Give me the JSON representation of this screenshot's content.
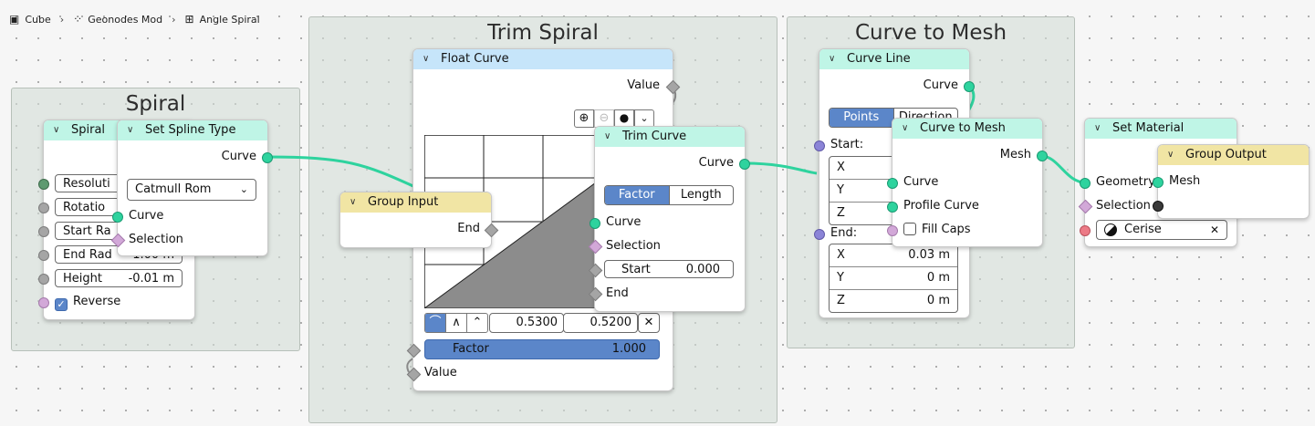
{
  "breadcrumb": [
    {
      "icon": "object-icon",
      "label": "Cube"
    },
    {
      "icon": "modifier-icon",
      "label": "Geonodes Mod"
    },
    {
      "icon": "node-tree-icon",
      "label": "Angle Spiral"
    }
  ],
  "frames": {
    "spiral": "Spiral",
    "trim": "Trim Spiral",
    "curve_to_mesh": "Curve to Mesh"
  },
  "spiral_node": {
    "title": "Spiral",
    "fields": [
      {
        "label": "Resoluti"
      },
      {
        "label": "Rotatio"
      },
      {
        "label": "Start Ra"
      },
      {
        "label": "End Rad",
        "value": "1.00 m"
      },
      {
        "label": "Height",
        "value": "-0.01 m"
      }
    ],
    "reverse_label": "Reverse",
    "reverse_checked": true
  },
  "set_spline_type": {
    "title": "Set Spline Type",
    "out_curve": "Curve",
    "dropdown": "Catmull Rom",
    "in_curve": "Curve",
    "in_selection": "Selection"
  },
  "group_input": {
    "title": "Group Input",
    "out_end": "End"
  },
  "float_curve": {
    "title": "Float Curve",
    "out_value": "Value",
    "handle_x": "0.5300",
    "handle_y": "0.5200",
    "factor_label": "Factor",
    "factor_value": "1.000",
    "in_value": "Value"
  },
  "trim_curve": {
    "title": "Trim Curve",
    "out_curve": "Curve",
    "mode_options": [
      "Factor",
      "Length"
    ],
    "mode_selected": "Factor",
    "in_curve": "Curve",
    "in_selection": "Selection",
    "start_label": "Start",
    "start_value": "0.000",
    "in_end": "End"
  },
  "curve_line": {
    "title": "Curve Line",
    "out_curve": "Curve",
    "mode_options": [
      "Points",
      "Direction"
    ],
    "mode_selected": "Points",
    "start_label": "Start:",
    "start": [
      {
        "axis": "X"
      },
      {
        "axis": "Y"
      },
      {
        "axis": "Z"
      }
    ],
    "end_label": "End:",
    "end": [
      {
        "axis": "X",
        "value": "0.03 m"
      },
      {
        "axis": "Y",
        "value": "0 m"
      },
      {
        "axis": "Z",
        "value": "0 m"
      }
    ]
  },
  "curve_to_mesh_node": {
    "title": "Curve to Mesh",
    "out_mesh": "Mesh",
    "in_curve": "Curve",
    "in_profile": "Profile Curve",
    "fill_caps": "Fill Caps",
    "fill_caps_checked": false
  },
  "set_material": {
    "title": "Set Material",
    "in_geometry": "Geometry",
    "in_selection": "Selection",
    "material": "Cerise"
  },
  "group_output": {
    "title": "Group Output",
    "in_mesh": "Mesh"
  },
  "colors": {
    "geometry_header": "#bff5e6",
    "utility_header": "#c6e5fa",
    "io_header": "#f1e5a4",
    "geometry_socket": "#2ed39e",
    "accent": "#5b86c9"
  }
}
